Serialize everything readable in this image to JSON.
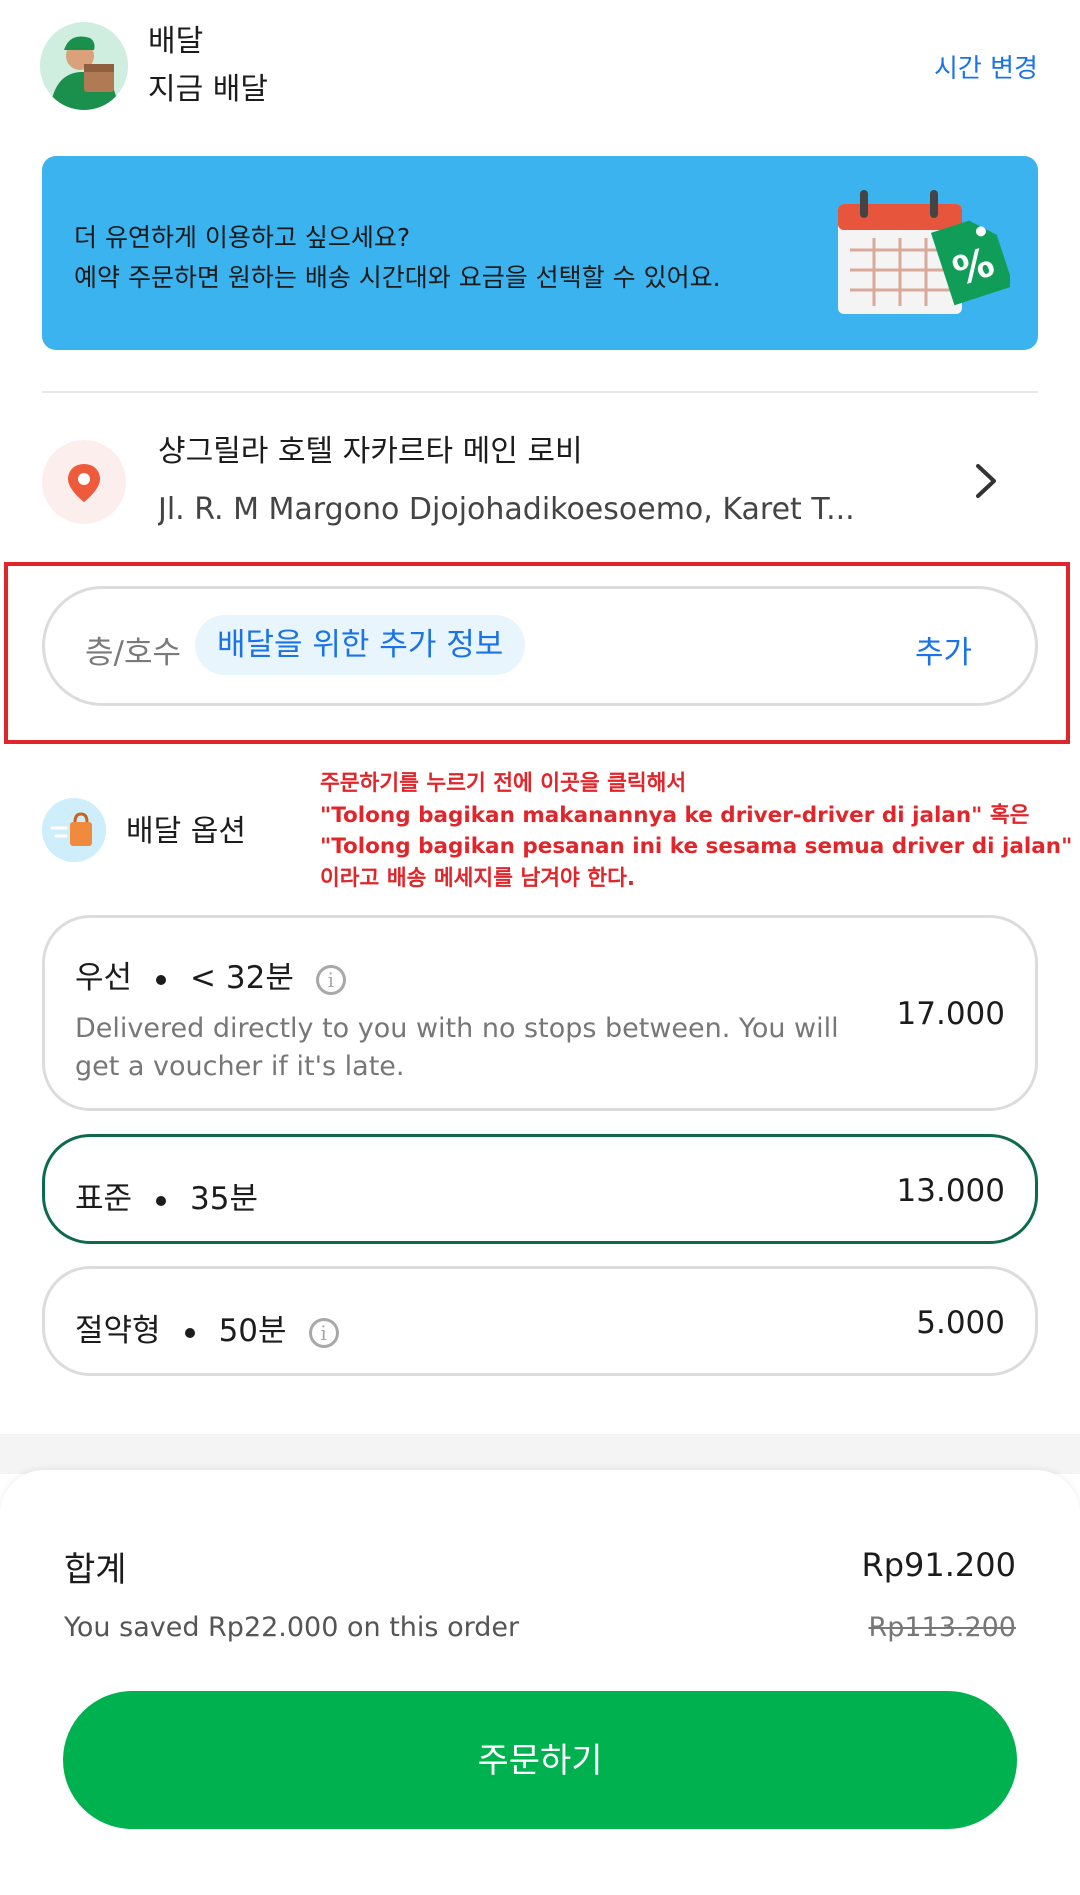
{
  "header": {
    "avatar_icon": "courier-avatar-icon",
    "delivery_type": "배달",
    "delivery_time": "지금 배달",
    "change_time_label": "시간 변경"
  },
  "banner": {
    "line1": "더 유연하게 이용하고 싶으세요?",
    "line2": "예약 주문하면 원하는 배송 시간대와 요금을 선택할 수 있어요.",
    "art_icon": "calendar-discount-icon"
  },
  "address": {
    "pin_icon": "location-pin-icon",
    "name": "샹그릴라 호텔 자카르타 메인 로비",
    "street": "Jl. R. M Margono Djojohadikoesoemo, Karet T...",
    "chevron_icon": "chevron-right-icon"
  },
  "note": {
    "floor_label": "층/호수",
    "chip_label": "배달을 위한 추가 정보",
    "add_label": "추가"
  },
  "instruction": {
    "line1": "주문하기를 누르기 전에 이곳을 클릭해서",
    "line2": "\"Tolong bagikan makanannya ke driver-driver di jalan\" 혹은",
    "line3": "\"Tolong bagikan pesanan ini ke sesama semua driver di jalan\"",
    "line4": "이라고 배송 메세지를 남겨야 한다."
  },
  "options": {
    "title": "배달 옵션",
    "icon": "delivery-bag-icon",
    "items": [
      {
        "name": "우선",
        "eta": "< 32분",
        "has_info": true,
        "description": "Delivered directly to you with no stops between. You will get a voucher if it's late.",
        "price": "17.000",
        "selected": false
      },
      {
        "name": "표준",
        "eta": "35분",
        "has_info": false,
        "description": "",
        "price": "13.000",
        "selected": true
      },
      {
        "name": "절약형",
        "eta": "50분",
        "has_info": true,
        "description": "",
        "price": "5.000",
        "selected": false
      }
    ]
  },
  "summary": {
    "total_label": "합계",
    "total_value": "Rp91.200",
    "saved_text": "You saved Rp22.000 on this order",
    "old_total": "Rp113.200",
    "order_button": "주문하기"
  },
  "colors": {
    "brand_green": "#00b14f",
    "link_blue": "#1a73e8",
    "banner_blue": "#3ab3ee",
    "annotation_red": "#e1262b",
    "selected_border": "#0d6b4a"
  }
}
